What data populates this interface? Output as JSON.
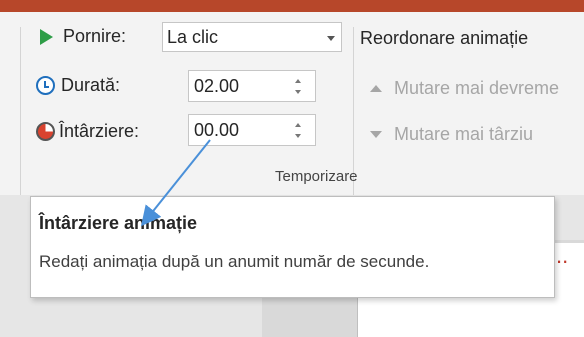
{
  "timing": {
    "start_label": "Pornire:",
    "start_value": "La clic",
    "duration_label": "Durată:",
    "duration_value": "02.00",
    "delay_label": "Întârziere:",
    "delay_value": "00.00",
    "group_label": "Temporizare"
  },
  "reorder": {
    "title": "Reordonare animație",
    "move_earlier": "Mutare mai devreme",
    "move_later": "Mutare mai târziu"
  },
  "tooltip": {
    "title": "Întârziere animație",
    "description": "Redați animația după un anumit număr de secunde."
  },
  "background": {
    "truncated_text": "i..."
  },
  "colors": {
    "accent_bar": "#b7472a",
    "play_green": "#2e9d47",
    "clock_blue": "#1f6fbd",
    "annotation_arrow": "#4a90d9"
  },
  "icons": [
    "play-icon",
    "clock-icon",
    "delay-clock-icon",
    "arrow-up-icon",
    "arrow-down-icon",
    "dropdown-caret-icon"
  ]
}
